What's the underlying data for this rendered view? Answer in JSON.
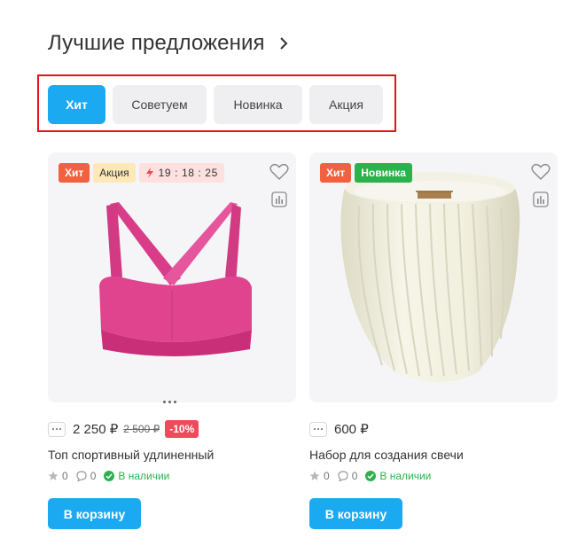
{
  "section": {
    "title": "Лучшие предложения"
  },
  "tabs": [
    {
      "label": "Хит",
      "active": true
    },
    {
      "label": "Советуем",
      "active": false
    },
    {
      "label": "Новинка",
      "active": false
    },
    {
      "label": "Акция",
      "active": false
    }
  ],
  "products": [
    {
      "badges": {
        "hit": "Хит",
        "promo": "Акция",
        "timer": "19 : 18 : 25"
      },
      "price": "2 250 ₽",
      "old_price": "2 500 ₽",
      "discount": "-10%",
      "name": "Топ спортивный удлиненный",
      "rating": "0",
      "reviews": "0",
      "stock": "В наличии",
      "cart_label": "В корзину",
      "color": "#e03c8e"
    },
    {
      "badges": {
        "hit": "Хит",
        "new": "Новинка"
      },
      "price": "600 ₽",
      "name": "Набор для создания свечи",
      "rating": "0",
      "reviews": "0",
      "stock": "В наличии",
      "cart_label": "В корзину",
      "color": "#efeedd"
    }
  ],
  "colors": {
    "accent": "#1baaf2",
    "hit": "#f1613f",
    "new": "#2bb24c",
    "discount": "#f14a5b"
  }
}
